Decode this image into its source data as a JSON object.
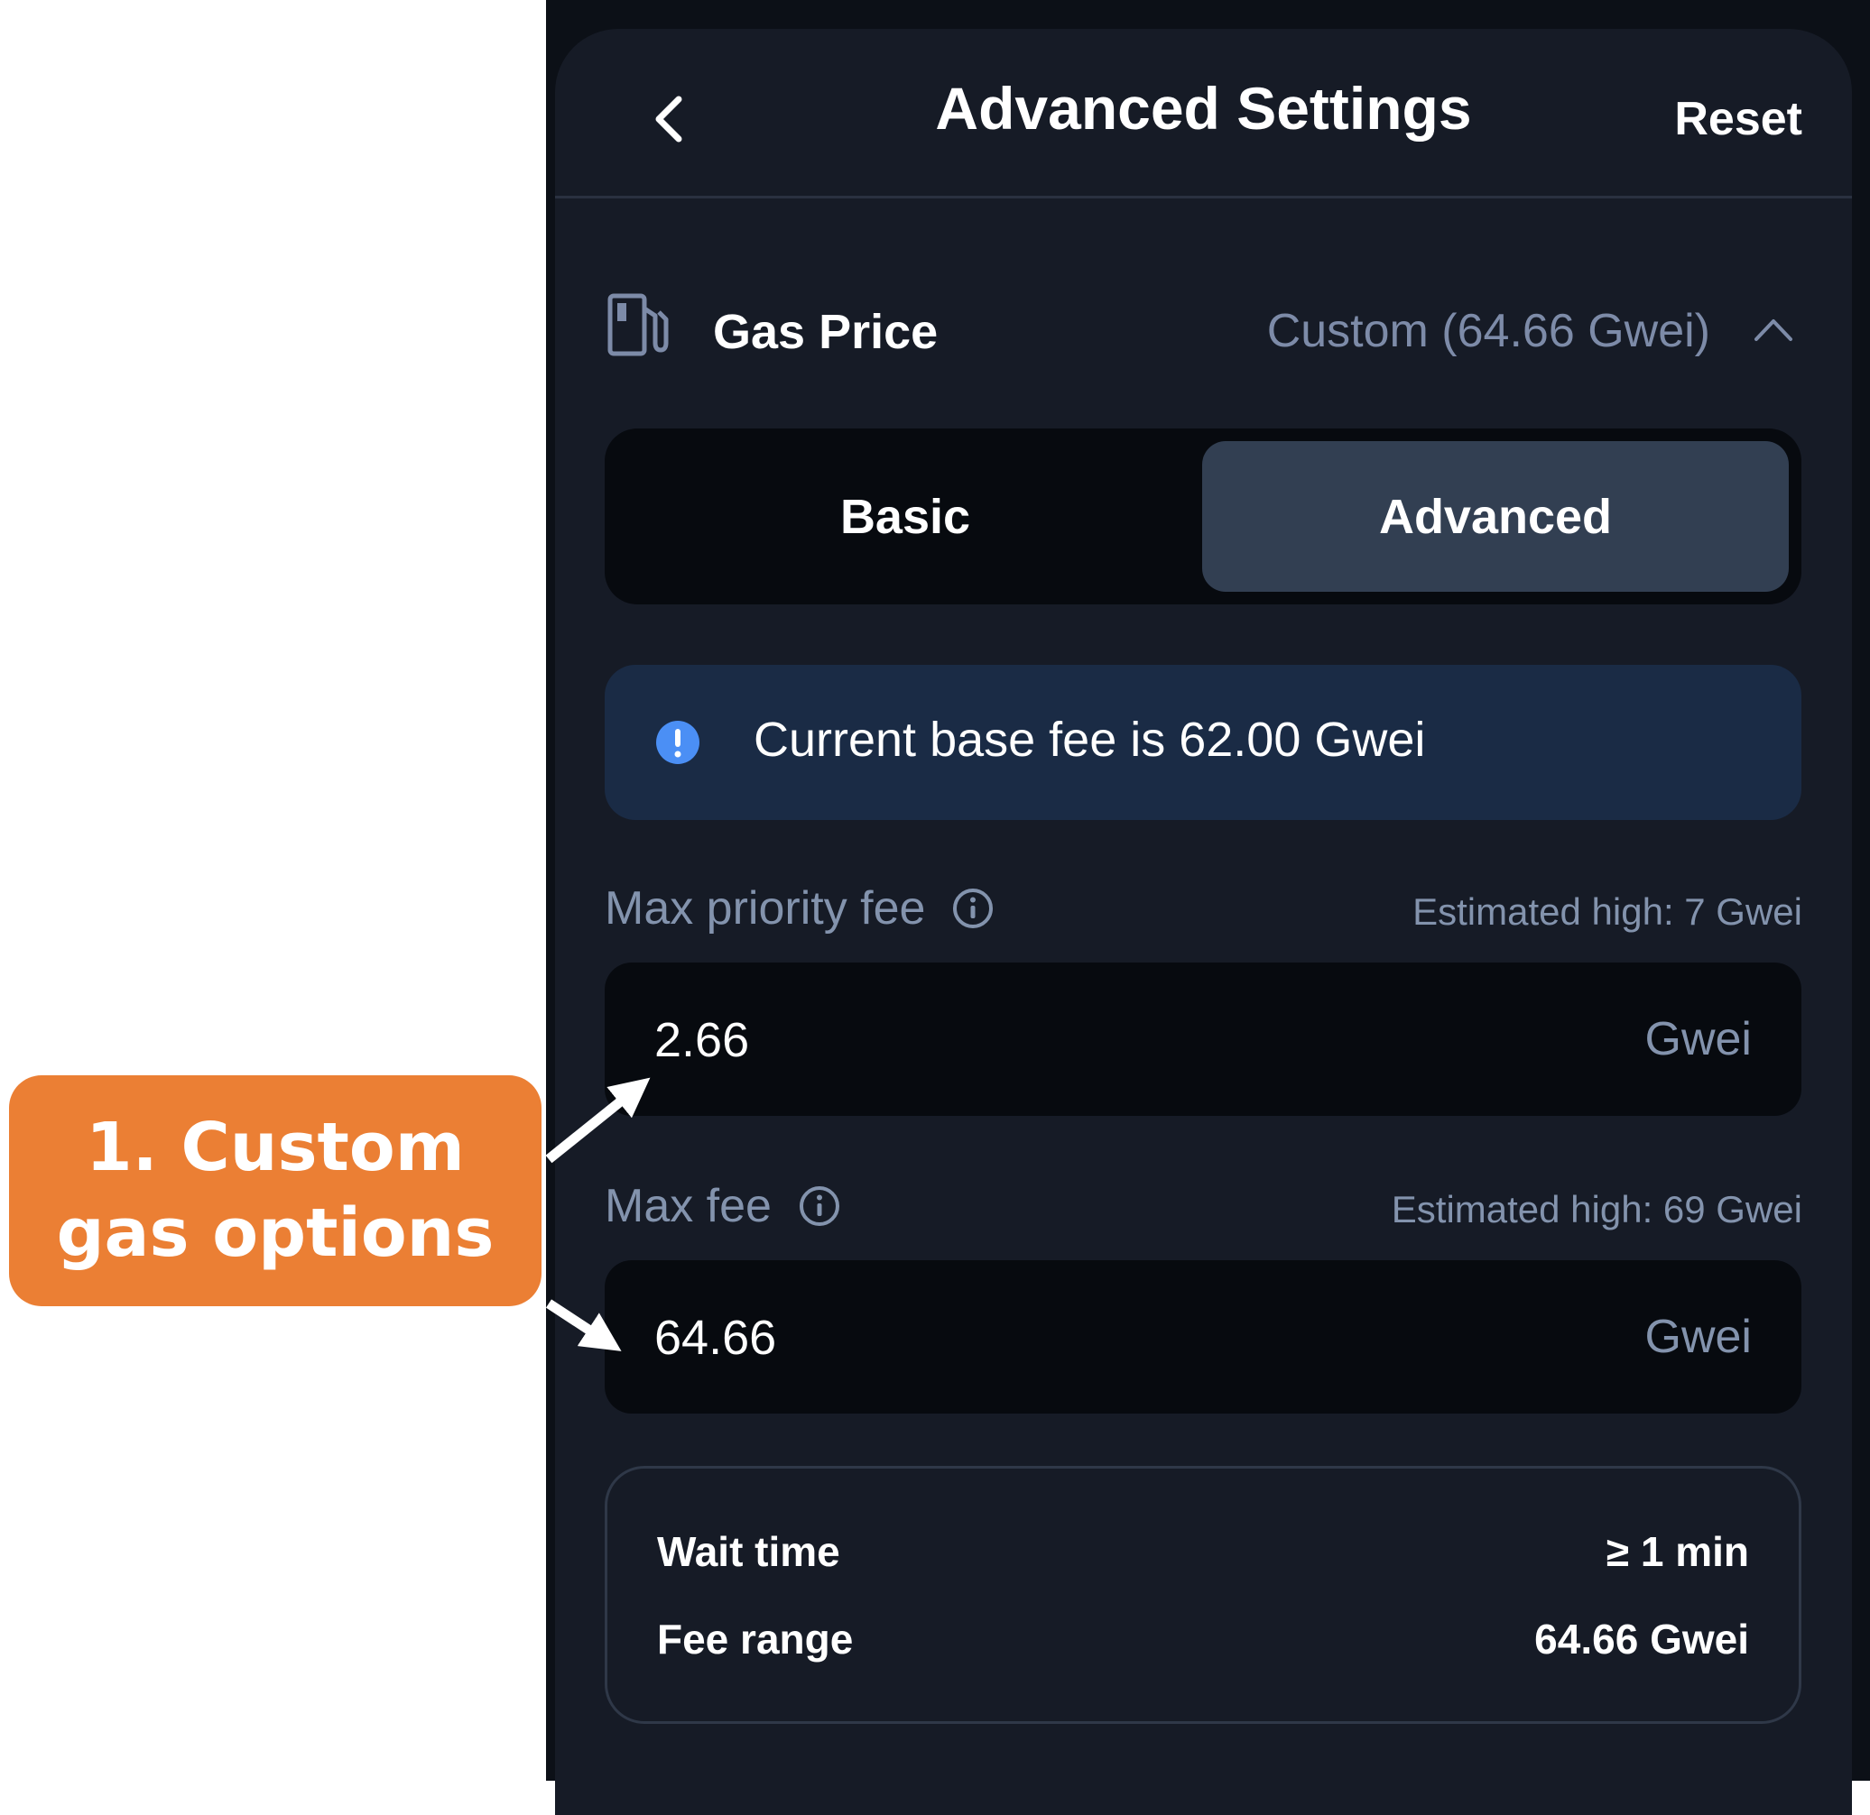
{
  "header": {
    "title": "Advanced Settings",
    "reset_label": "Reset"
  },
  "gas_price": {
    "label": "Gas Price",
    "value": "Custom (64.66 Gwei)"
  },
  "mode_toggle": {
    "options": [
      "Basic",
      "Advanced"
    ],
    "selected": "Advanced"
  },
  "info": {
    "text": "Current base fee is 62.00 Gwei"
  },
  "max_priority_fee": {
    "label": "Max priority fee",
    "hint": "Estimated high: 7 Gwei",
    "value": "2.66",
    "unit": "Gwei"
  },
  "max_fee": {
    "label": "Max fee",
    "hint": "Estimated high: 69 Gwei",
    "value": "64.66",
    "unit": "Gwei"
  },
  "summary": {
    "rows": [
      {
        "label": "Wait time",
        "value": "≥ 1 min"
      },
      {
        "label": "Fee range",
        "value": "64.66 Gwei"
      }
    ]
  },
  "annotation": {
    "lines": [
      "1. Custom",
      "gas options"
    ],
    "color": "#eb7f34"
  },
  "colors": {
    "panel": "#161b26",
    "selected_segment": "#323f52",
    "info_banner": "#1a2b45",
    "info_icon": "#4b8ff5",
    "muted_text": "#8393ad"
  }
}
